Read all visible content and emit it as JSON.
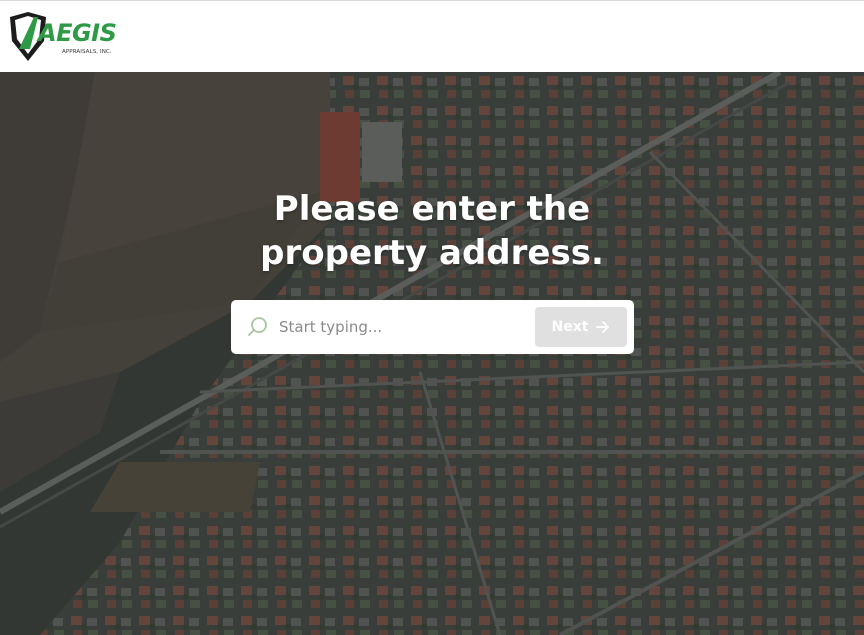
{
  "brand": {
    "name": "AEGIS",
    "subtitle": "APPRAISALS, INC.",
    "accent_color": "#2f9a45"
  },
  "hero": {
    "headline_line1": "Please enter the",
    "headline_line2": "property address.",
    "background": "aerial-neighborhood-photo"
  },
  "search": {
    "placeholder": "Start typing...",
    "value": "",
    "icon": "search-icon"
  },
  "next_button": {
    "label": "Next",
    "icon": "arrow-right-icon",
    "state": "disabled"
  }
}
